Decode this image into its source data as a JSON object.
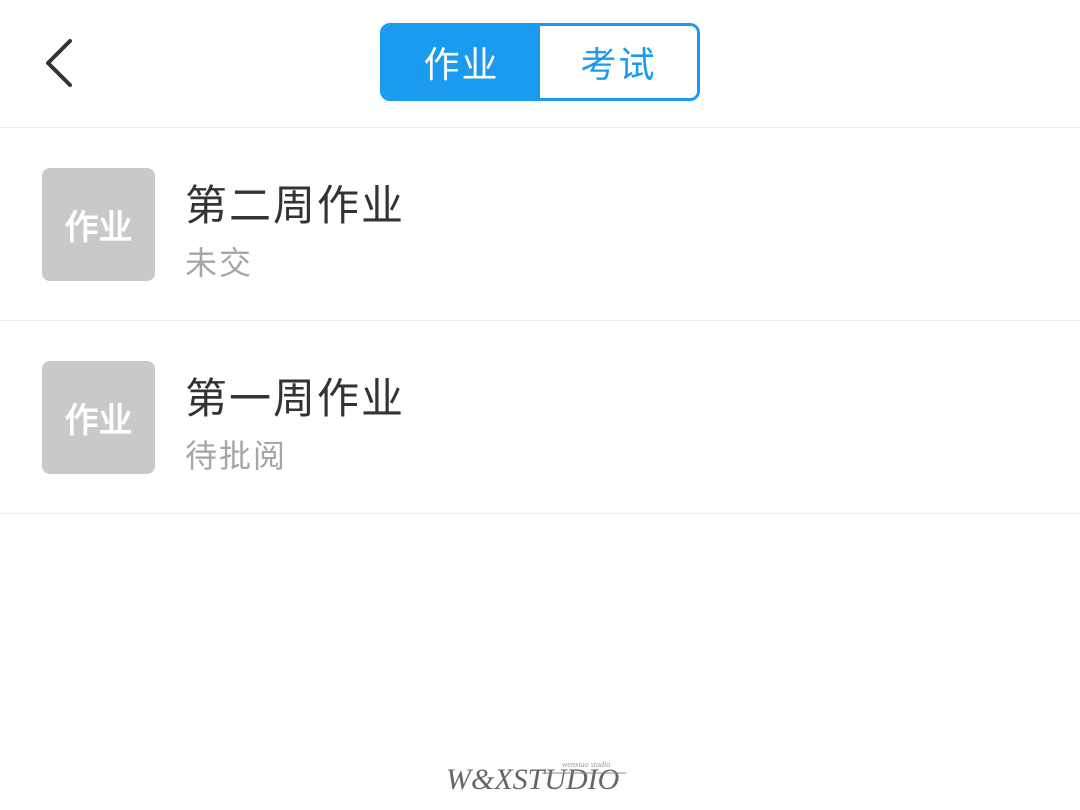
{
  "tabs": {
    "homework": "作业",
    "exam": "考试"
  },
  "assignments": [
    {
      "thumb_label": "作业",
      "title": "第二周作业",
      "status": "未交"
    },
    {
      "thumb_label": "作业",
      "title": "第一周作业",
      "status": "待批阅"
    }
  ],
  "watermark": {
    "main": "W&XSTUDIO",
    "small": "wenxiao studio"
  },
  "colors": {
    "accent": "#1a9bf0",
    "thumb_bg": "#c8c9ca",
    "title_text": "#333333",
    "status_text": "#a6a6a6"
  },
  "icons": {
    "back": "chevron-left-icon"
  }
}
